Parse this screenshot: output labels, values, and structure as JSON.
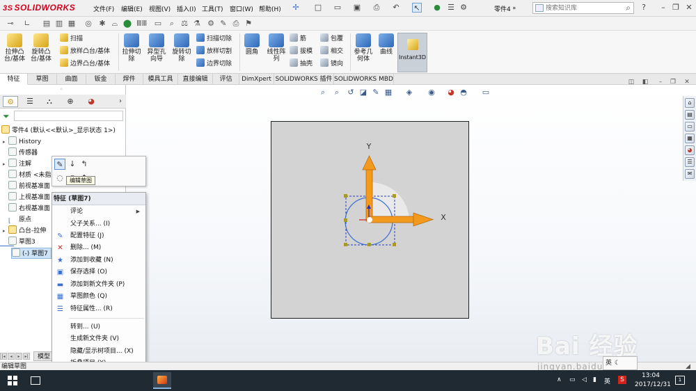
{
  "titlebar": {
    "logo_ds": "3S",
    "logo_text": "SOLIDWORKS",
    "menus": [
      "文件(F)",
      "编辑(E)",
      "视图(V)",
      "插入(I)",
      "工具(T)",
      "窗口(W)",
      "帮助(H)"
    ],
    "doc_title": "零件4 *",
    "search_placeholder": "搜索知识库",
    "help_label": "?"
  },
  "ribbon": {
    "big_buttons": [
      {
        "label": "拉伸凸\n台/基体"
      },
      {
        "label": "旋转凸\n台/基体"
      },
      {
        "label": "拉伸切\n除"
      },
      {
        "label": "异型孔\n向导"
      },
      {
        "label": "旋转切\n除"
      },
      {
        "label": "圆角"
      },
      {
        "label": "线性阵\n列"
      },
      {
        "label": "参考几\n何体"
      },
      {
        "label": "曲线"
      }
    ],
    "small_buttons": [
      {
        "label": "扫描"
      },
      {
        "label": "放样凸台/基体"
      },
      {
        "label": "边界凸台/基体"
      },
      {
        "label": "扫描切除"
      },
      {
        "label": "放样切割"
      },
      {
        "label": "边界切除"
      },
      {
        "label": "筋"
      },
      {
        "label": "拔模"
      },
      {
        "label": "抽壳"
      },
      {
        "label": "包覆"
      },
      {
        "label": "相交"
      },
      {
        "label": "镜向"
      }
    ],
    "instant3d_label": "Instant3D"
  },
  "command_tabs": [
    "特征",
    "草图",
    "曲面",
    "钣金",
    "焊件",
    "模具工具",
    "直接编辑",
    "评估",
    "DimXpert",
    "SOLIDWORKS 插件",
    "SOLIDWORKS MBD"
  ],
  "feature_tree": {
    "root": "零件4 (默认<<默认>_显示状态 1>)",
    "items": [
      {
        "label": "History"
      },
      {
        "label": "传感器"
      },
      {
        "label": "注解"
      },
      {
        "label": "材质 <未指"
      },
      {
        "label": "前视基准面"
      },
      {
        "label": "上视基准面"
      },
      {
        "label": "右视基准面"
      },
      {
        "label": "原点"
      },
      {
        "label": "凸台-拉伸"
      },
      {
        "label": "草图3"
      },
      {
        "label": "(-) 草图7"
      }
    ],
    "model_tab": "模型"
  },
  "context_toolbar": {
    "tooltip": "编辑草图"
  },
  "context_menu": {
    "header": "特征 (草图7)",
    "items": [
      {
        "label": "评论",
        "submenu": true
      },
      {
        "label": "父子关系... (I)"
      },
      {
        "label": "配置特征 (J)"
      },
      {
        "label": "删除... (M)"
      },
      {
        "label": "添加到收藏 (N)"
      },
      {
        "label": "保存选择 (O)"
      },
      {
        "label": "添加到新文件夹 (P)"
      },
      {
        "label": "草图颜色 (Q)"
      },
      {
        "label": "特征属性... (R)"
      },
      {
        "label": "转到... (U)"
      },
      {
        "label": "生成新文件夹 (V)"
      },
      {
        "label": "隐藏/显示树项目... (X)"
      },
      {
        "label": "折叠项目 (Y)"
      }
    ],
    "more": "⌄"
  },
  "viewport": {
    "axis_x": "X",
    "axis_y": "Y",
    "orange": "#f39a1e",
    "sketch_blue": "#3a6fd0"
  },
  "statusbar": {
    "text": "编辑草图"
  },
  "taskbar": {
    "ime": "英",
    "time": "13:04",
    "date": "2017/12/31",
    "notif_count": "1"
  },
  "watermark": {
    "main": "Bai 经验",
    "url": "jingyan.baidu.com"
  },
  "ime_box": "英"
}
